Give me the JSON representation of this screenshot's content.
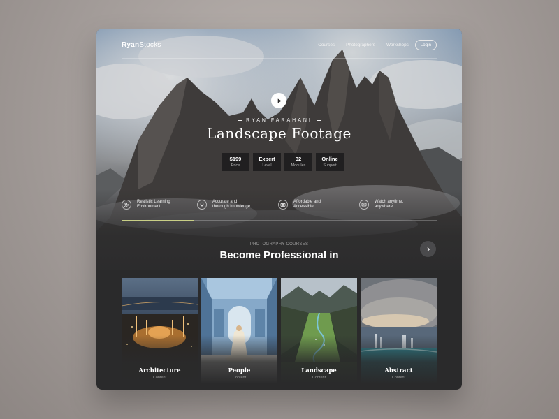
{
  "brand": {
    "logo_bold": "Ryan",
    "logo_light": "Stocks"
  },
  "nav": {
    "links": [
      "Courses",
      "Photographers",
      "Workshops"
    ],
    "login_label": "Login"
  },
  "hero": {
    "photographer": "RYAN FARAHANI",
    "title": "Landscape Footage",
    "stats": [
      {
        "value": "$199",
        "label": "Price"
      },
      {
        "value": "Expert",
        "label": "Level"
      },
      {
        "value": "32",
        "label": "Modules"
      },
      {
        "value": "Online",
        "label": "Support"
      }
    ],
    "features": [
      {
        "icon": "learning-icon",
        "line1": "Realistic Learning",
        "line2": "Environment"
      },
      {
        "icon": "lightbulb-icon",
        "line1": "Accurate and",
        "line2": "thorough knowledge"
      },
      {
        "icon": "camera-icon",
        "line1": "Affordable and",
        "line2": "Accessible"
      },
      {
        "icon": "video-icon",
        "line1": "Watch anytime,",
        "line2": "anywhere"
      }
    ],
    "progress_fraction": 0.23,
    "progress_color": "#c9cf86"
  },
  "section": {
    "tag": "PHOTOGRAPHY COURSES",
    "title": "Become Professional in"
  },
  "categories": [
    {
      "name": "Architecture",
      "sub": "Content"
    },
    {
      "name": "People",
      "sub": "Content"
    },
    {
      "name": "Landscape",
      "sub": "Content"
    },
    {
      "name": "Abstract",
      "sub": "Content"
    }
  ]
}
